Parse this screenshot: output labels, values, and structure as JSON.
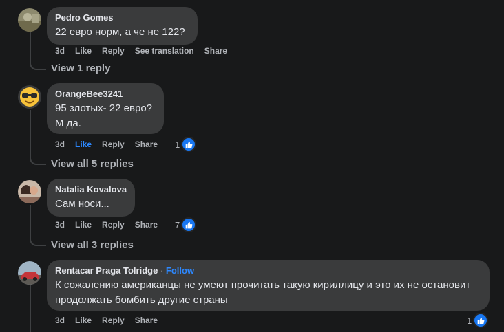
{
  "comments": [
    {
      "author": "Pedro Gomes",
      "text": "22 евро норм, а че не 122?",
      "age": "3d",
      "like_label": "Like",
      "reply_label": "Reply",
      "translate_label": "See translation",
      "share_label": "Share",
      "view_replies": "View 1 reply"
    },
    {
      "author": "OrangeBee3241",
      "text": "95 злотых- 22 евро?\nМ да.",
      "age": "3d",
      "like_label": "Like",
      "liked": true,
      "reply_label": "Reply",
      "share_label": "Share",
      "reactions_count": "1",
      "view_replies": "View all 5 replies"
    },
    {
      "author": "Natalia Kovalova",
      "text": "Сам носи...",
      "age": "3d",
      "like_label": "Like",
      "reply_label": "Reply",
      "share_label": "Share",
      "reactions_count": "7",
      "view_replies": "View all 3 replies"
    },
    {
      "author": "Rentacar Praga Tolridge",
      "separator": "·",
      "follow_label": "Follow",
      "text": "К сожалению американцы не умеют прочитать такую кириллицу и это их не остановит продолжать бомбить другие страны",
      "age": "3d",
      "like_label": "Like",
      "reply_label": "Reply",
      "share_label": "Share",
      "reactions_count": "1"
    }
  ],
  "colors": {
    "background": "#18191a",
    "bubble": "#3a3b3c",
    "text": "#e4e6eb",
    "secondary_text": "#b0b3b8",
    "accent": "#2d88ff",
    "like_badge": "#1877f2"
  },
  "icons": {
    "reaction": "thumbs-up-icon",
    "avatar_2": "sunglasses-emoji-avatar"
  }
}
